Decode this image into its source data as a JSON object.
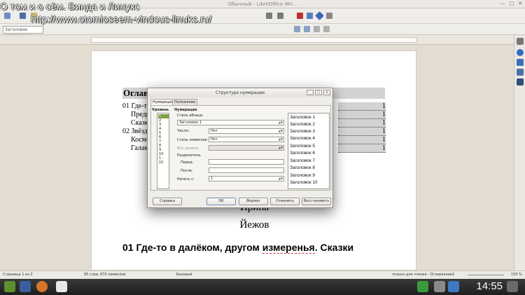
{
  "window": {
    "title": "Обычный - LibreOffice Wri..."
  },
  "watermark": {
    "line1": "О том и о сём. Винда и Линукс",
    "line2": "http://www.otomioseem-vindous-linuks.ru/"
  },
  "toolbar": {
    "style_box": "Заголовок оглавления"
  },
  "document": {
    "toc_heading": "Оглав",
    "toc_lines": [
      {
        "text": "01 Где-то",
        "indent": 0,
        "page": "1"
      },
      {
        "text": "Предис",
        "indent": 1,
        "page": "1"
      },
      {
        "text": "Сказк",
        "indent": 1,
        "page": "1"
      },
      {
        "text": "02 Звёзд",
        "indent": 0,
        "page": "1"
      },
      {
        "text": "Космо",
        "indent": 1,
        "page": "1"
      },
      {
        "text": "Галакт",
        "indent": 1,
        "page": "1"
      }
    ],
    "author_first": "Ирина",
    "author_last": "Йежов",
    "chapter_prefix": "01 Где-то в далёком, другом ",
    "chapter_misspelled": "измеренья",
    "chapter_suffix": ". Сказки"
  },
  "dialog": {
    "title": "Структура нумерации",
    "tabs": [
      "Нумерация",
      "Положение"
    ],
    "levels_header": "Уровень",
    "levels": [
      "1",
      "2",
      "3",
      "4",
      "5",
      "6",
      "7",
      "8",
      "9",
      "10",
      "1 - 10"
    ],
    "selected_level_index": 0,
    "numbering_header": "Нумерация",
    "paragraph_style_label": "Стиль абзаца:",
    "paragraph_style_value": "Заголовок 1",
    "number_label": "Число:",
    "number_value": "Нет",
    "char_style_label": "Стиль символов:",
    "char_style_value": "Нет",
    "show_levels_label": "Все уровни:",
    "separator_label": "Разделитель",
    "before_label": "Перед:",
    "before_value": "",
    "after_label": "После:",
    "after_value": "",
    "start_label": "Начать с:",
    "start_value": "1",
    "preview_items": [
      "Заголовок 1",
      "Заголовок 2",
      "Заголовок 3",
      "Заголовок 4",
      "Заголовок 5",
      "Заголовок 6",
      "Заголовок 7",
      "Заголовок 8",
      "Заголовок 9",
      "Заголовок 10"
    ],
    "buttons": {
      "help": "Справка",
      "ok": "ОК",
      "format": "Формат",
      "cancel": "Отменить",
      "reset": "Восстановить"
    }
  },
  "statusbar": {
    "page": "Страница 1 из 2",
    "words": "95 слов, 670 символов",
    "style": "Базовый",
    "mode": "только для чтения - Оглавление1",
    "zoom": "150 %"
  },
  "taskbar": {
    "time": "14:55"
  },
  "colors": {
    "selection": "#7aa33d",
    "toc_shade": "#d3d3d3"
  }
}
